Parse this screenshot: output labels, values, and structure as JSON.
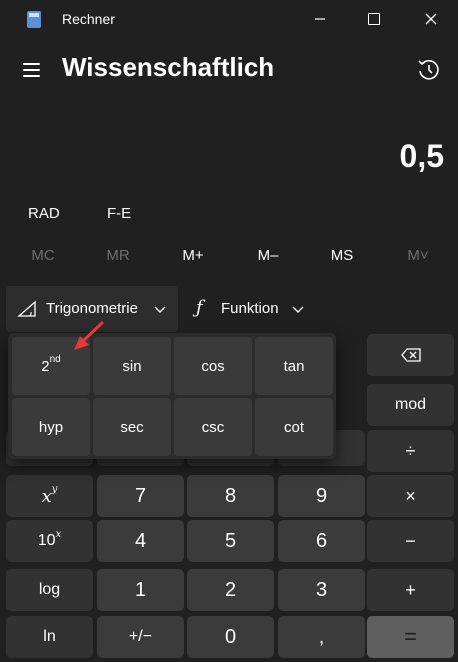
{
  "window": {
    "title": "Rechner"
  },
  "header": {
    "mode_title": "Wissenschaftlich"
  },
  "display": {
    "value": "0,5"
  },
  "modes": {
    "angle": "RAD",
    "fe": "F-E"
  },
  "memory": [
    "MC",
    "MR",
    "M+",
    "M–",
    "MS",
    "M˅"
  ],
  "function_bar": {
    "trig_label": "Trigonometrie",
    "func_label": "Funktion",
    "func_icon": "ƒ"
  },
  "trig_flyout": {
    "second": {
      "base": "2",
      "sup": "nd"
    },
    "keys": [
      "sin",
      "cos",
      "tan",
      "hyp",
      "sec",
      "csc",
      "cot"
    ]
  },
  "keypad": {
    "backspace": "⌫",
    "mod": "mod",
    "divide": "÷",
    "multiply": "×",
    "minus": "−",
    "plus": "+",
    "equals": "=",
    "xy": {
      "base": "x",
      "sup": "y"
    },
    "tenx": {
      "base": "10",
      "sup": "x"
    },
    "log": "log",
    "ln": "ln",
    "negate": "+/−",
    "comma": ",",
    "digits": {
      "0": "0",
      "1": "1",
      "2": "2",
      "3": "3",
      "4": "4",
      "5": "5",
      "6": "6",
      "7": "7",
      "8": "8",
      "9": "9"
    }
  },
  "colors": {
    "background": "#202020",
    "key_dark": "#323232",
    "key_number": "#3b3b3b",
    "equals": "#5f5f5f",
    "arrow": "#e53935"
  }
}
